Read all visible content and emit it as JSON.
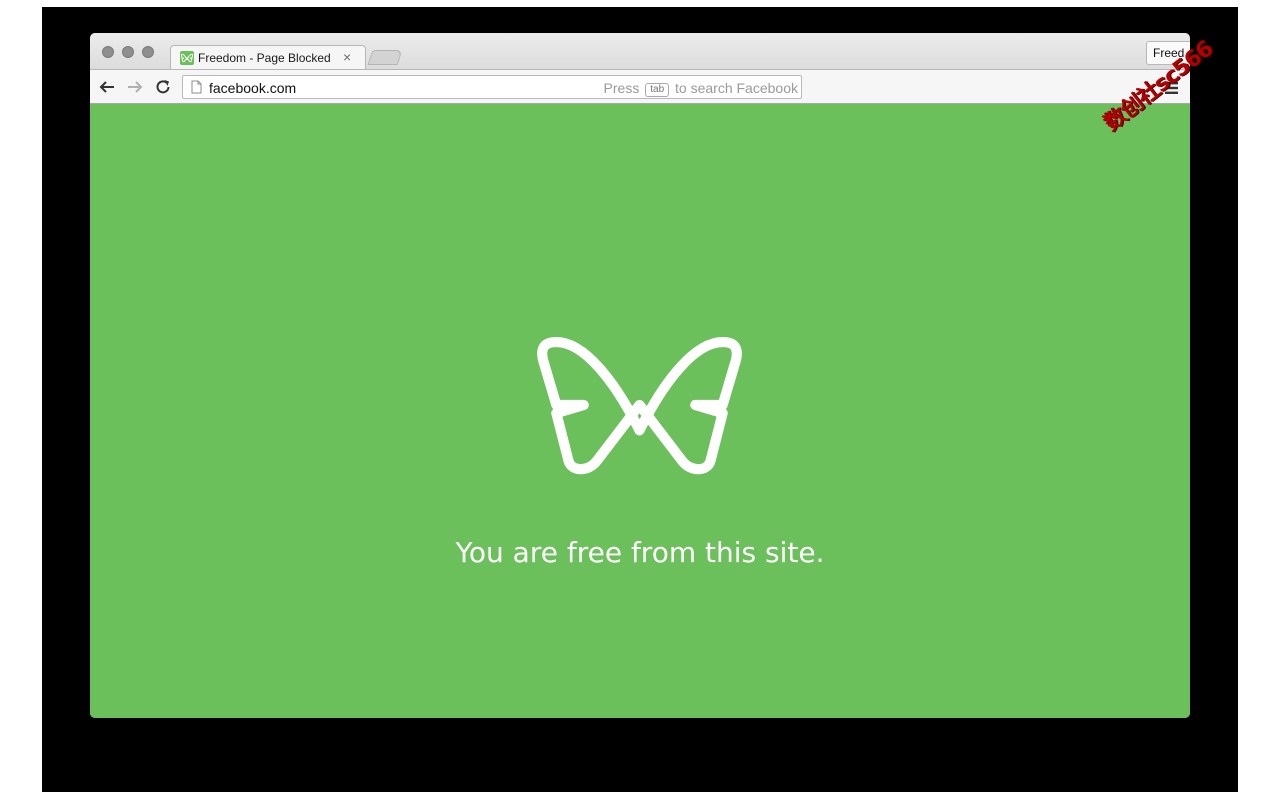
{
  "browser": {
    "tab": {
      "title": "Freedom - Page Blocked",
      "close_label": "×"
    },
    "profile_button_label": "Freed",
    "omnibox": {
      "url": "facebook.com",
      "hint_prefix": "Press",
      "hint_key": "tab",
      "hint_suffix": "to search Facebook"
    }
  },
  "page": {
    "background_color": "#6cc05b",
    "logo_icon": "butterfly-icon",
    "message": "You are free from this site."
  },
  "watermark": {
    "text": "数创社sc566"
  }
}
